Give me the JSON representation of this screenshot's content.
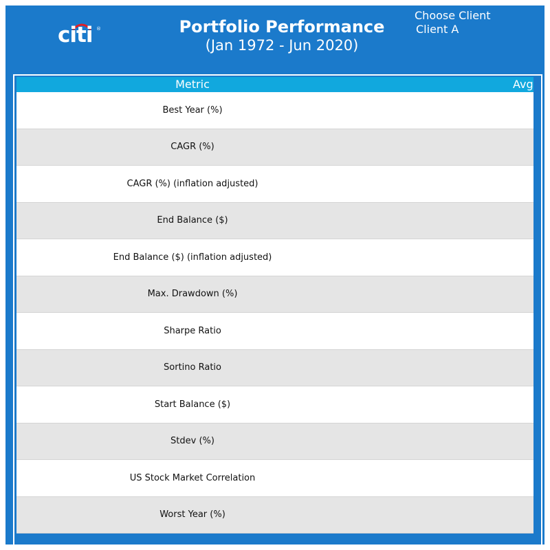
{
  "header": {
    "logo_text": "citi",
    "title": "Portfolio Performance",
    "subtitle": "(Jan 1972 - Jun 2020)",
    "client_label": "Choose Client",
    "client_value": "Client A"
  },
  "table": {
    "columns": [
      "Metric",
      "Avg"
    ],
    "rows": [
      {
        "metric": "Best Year (%)"
      },
      {
        "metric": "CAGR (%)"
      },
      {
        "metric": "CAGR (%) (inflation adjusted)"
      },
      {
        "metric": "End Balance ($)"
      },
      {
        "metric": "End Balance ($) (inflation adjusted)"
      },
      {
        "metric": "Max. Drawdown (%)"
      },
      {
        "metric": "Sharpe Ratio"
      },
      {
        "metric": "Sortino Ratio"
      },
      {
        "metric": "Start Balance ($)"
      },
      {
        "metric": "Stdev (%)"
      },
      {
        "metric": "US Stock Market Correlation"
      },
      {
        "metric": "Worst Year (%)"
      }
    ]
  },
  "colors": {
    "frame_blue": "#1b7acb",
    "header_cyan": "#11a8de",
    "row_alt_gray": "#e5e5e5"
  }
}
